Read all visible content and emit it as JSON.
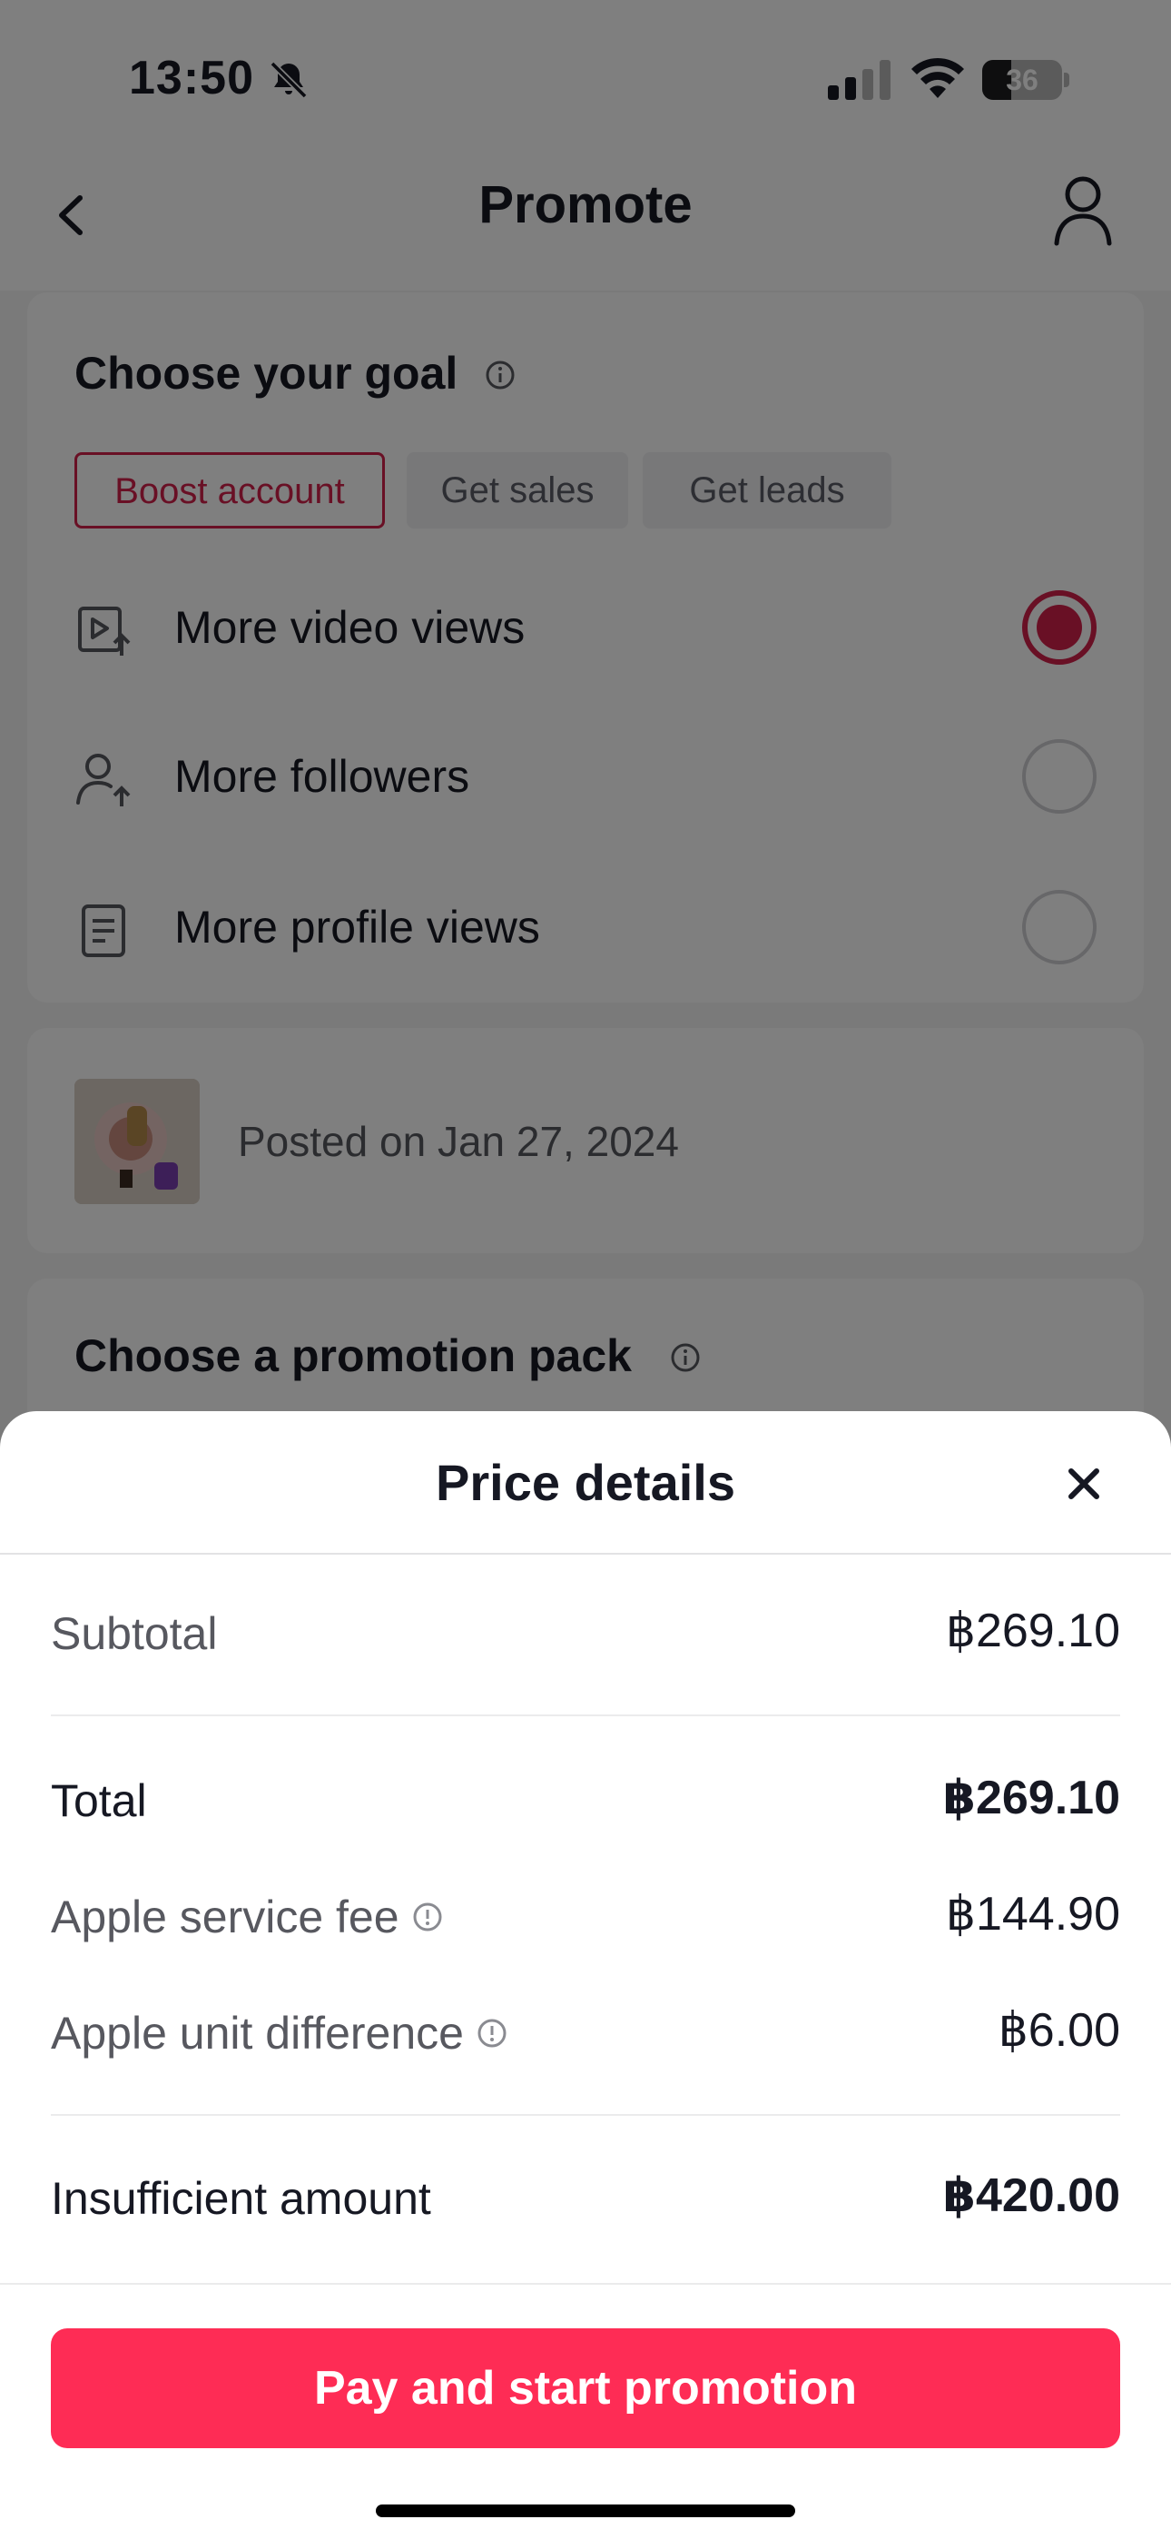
{
  "status_bar": {
    "time": "13:50",
    "battery": "36",
    "battery_level": 0.36,
    "icons": [
      "bell-slash-icon",
      "cellular-signal-icon",
      "wifi-icon",
      "battery-icon"
    ]
  },
  "nav": {
    "title": "Promote",
    "icons": [
      "chevron-left-icon",
      "person-icon"
    ]
  },
  "goal": {
    "heading": "Choose your goal",
    "chips": [
      "Boost account",
      "Get sales",
      "Get leads"
    ],
    "selected_chip": "Boost account",
    "options": [
      {
        "label": "More video views",
        "icon": "video-up-icon",
        "selected": true
      },
      {
        "label": "More followers",
        "icon": "person-up-icon",
        "selected": false
      },
      {
        "label": "More profile views",
        "icon": "document-icon",
        "selected": false
      }
    ]
  },
  "post": {
    "text": "Posted on Jan 27, 2024"
  },
  "pack": {
    "heading": "Choose a promotion pack"
  },
  "price_sheet": {
    "title": "Price details",
    "subtotal_label": "Subtotal",
    "subtotal_value": "฿269.10",
    "total_label": "Total",
    "total_value": "฿269.10",
    "service_fee_label": "Apple service fee",
    "service_fee_value": "฿144.90",
    "unit_diff_label": "Apple unit difference",
    "unit_diff_value": "฿6.00",
    "insufficient_label": "Insufficient amount",
    "insufficient_value": "฿420.00",
    "pay_button": "Pay and start promotion"
  },
  "colors": {
    "accent": "#d2204b",
    "pay_button": "#fe2c55",
    "text": "#161823",
    "muted": "#57585f"
  }
}
